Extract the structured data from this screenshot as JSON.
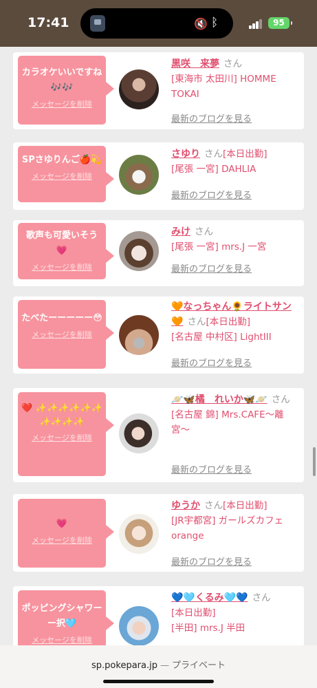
{
  "status_bar": {
    "time": "17:41",
    "battery": "95",
    "icons": [
      "app-icon",
      "mute-icon",
      "bluetooth-icon",
      "signal-icon",
      "wifi-icon",
      "battery-icon"
    ]
  },
  "common": {
    "delete_label": "メッセージを削除",
    "blog_label": "最新のブログを見る",
    "san": "さん"
  },
  "cards": [
    {
      "message": "カラオケいいですね🎶🎶",
      "name": "黒咲　来夢",
      "status": "",
      "area": "[東海市 太田川] HOMME TOKAI"
    },
    {
      "message": "SPさゆりんご🍎💫",
      "name": "さゆり",
      "status": "[本日出勤]",
      "area": "[尾張 一宮] DAHLIA"
    },
    {
      "message": "歌声も可愛いそう💗",
      "name": "みけ",
      "status": "",
      "area": "[尾張 一宮] mrs.J 一宮"
    },
    {
      "message": "たべたーーーーー😳",
      "name": "🧡なっちゃん🌻ライトサン🧡",
      "status": "[本日出勤]",
      "area": "[名古屋 中村区] LightIII"
    },
    {
      "message": "❤️ ✨✨✨✨✨✨ ✨✨✨✨",
      "name": "🪐🦋橘　れいか🦋🪐",
      "status": "",
      "area": "[名古屋 錦] Mrs.CAFE〜離宮〜"
    },
    {
      "message": "💗",
      "name": "ゆうか",
      "status": "[本日出勤]",
      "area": "[JR宇都宮] ガールズカフェorange"
    },
    {
      "message": "ポッピングシャワーー択🩵",
      "name": "💙🩵くるみ🩵💙",
      "status": "[本日出勤]",
      "area": "[半田] mrs.J 半田"
    }
  ],
  "url_bar": {
    "host": "sp.pokepara.jp",
    "separator": "—",
    "mode": "プライベート"
  },
  "colors": {
    "bubble": "#f7939e",
    "accent": "#e04e6e",
    "status_bar": "#5b4b3d",
    "battery": "#63d66a"
  }
}
